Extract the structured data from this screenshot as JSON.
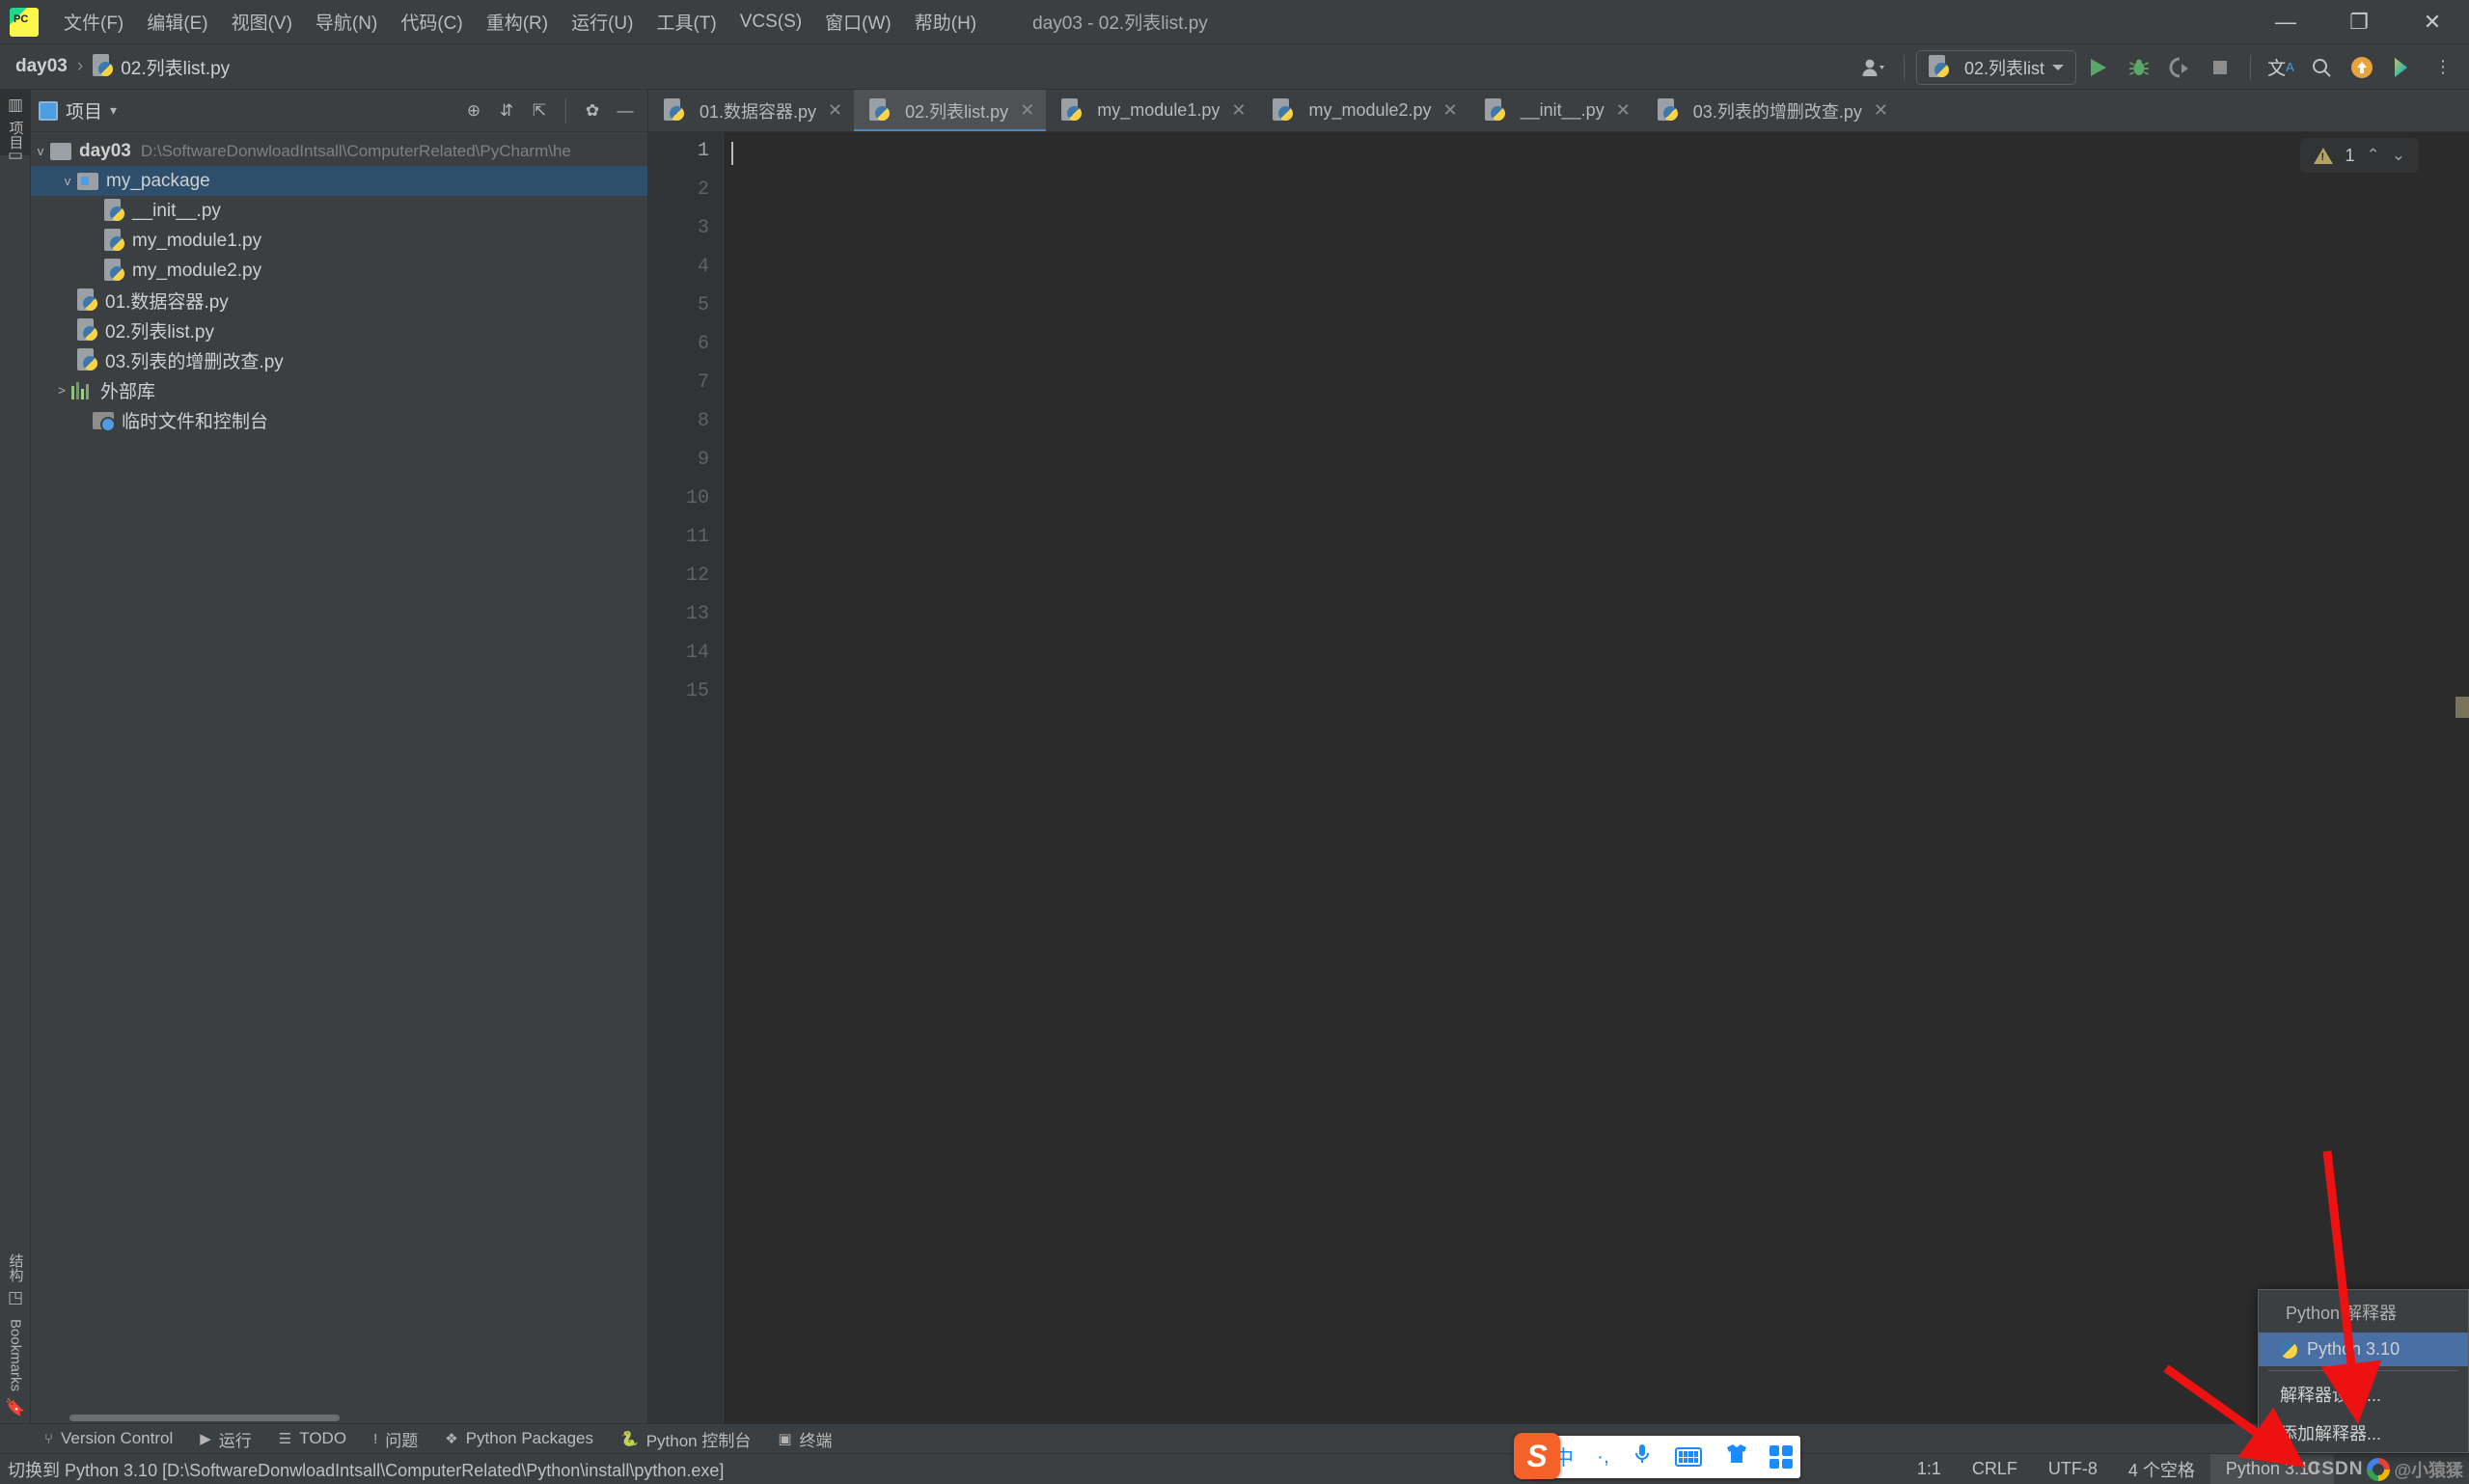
{
  "window": {
    "title": "day03 - 02.列表list.py",
    "minimize_label": "—",
    "maximize_label": "❐",
    "close_label": "✕"
  },
  "menu": {
    "items": [
      {
        "label": "文件(F)"
      },
      {
        "label": "编辑(E)"
      },
      {
        "label": "视图(V)"
      },
      {
        "label": "导航(N)"
      },
      {
        "label": "代码(C)"
      },
      {
        "label": "重构(R)"
      },
      {
        "label": "运行(U)"
      },
      {
        "label": "工具(T)"
      },
      {
        "label": "VCS(S)"
      },
      {
        "label": "窗口(W)"
      },
      {
        "label": "帮助(H)"
      }
    ]
  },
  "breadcrumb": {
    "project": "day03",
    "separator": "›",
    "file": "02.列表list.py"
  },
  "nav_right": {
    "account_icon": "user-icon",
    "run_config": "02.列表list",
    "run_tooltip": "运行",
    "debug_tooltip": "调试",
    "coverage_tooltip": "运行覆盖率",
    "stop_tooltip": "停止",
    "translate_icon": "文A",
    "search_icon": "⌕",
    "update_icon": "↑",
    "ai_icon": "▶",
    "more_icon": "⋮"
  },
  "toolstrip": {
    "top": [
      {
        "label": "项目",
        "icon": "project-icon",
        "active": true
      },
      {
        "label": "",
        "icon": "commit-icon",
        "active": false
      }
    ],
    "bottom": [
      {
        "label": "结构",
        "icon": "structure-icon"
      },
      {
        "label": "Bookmarks",
        "icon": "bookmark-icon"
      }
    ]
  },
  "project_panel": {
    "title": "项目",
    "dropdown_caret": "▾",
    "actions": [
      {
        "name": "locate-icon",
        "glyph": "⊕"
      },
      {
        "name": "expand-all-icon",
        "glyph": "⇵"
      },
      {
        "name": "collapse-all-icon",
        "glyph": "⇱"
      },
      {
        "name": "settings-gear-icon",
        "glyph": "✿"
      },
      {
        "name": "hide-panel-icon",
        "glyph": "—"
      }
    ],
    "tree": [
      {
        "label": "day03",
        "path": "D:\\SoftwareDonwloadIntsall\\ComputerRelated\\PyCharm\\he",
        "type": "folder",
        "indent": 0,
        "arrow": "v",
        "bold": true,
        "selected": false
      },
      {
        "label": "my_package",
        "path": "",
        "type": "package",
        "indent": 1,
        "arrow": "v",
        "bold": false,
        "selected": true
      },
      {
        "label": "__init__.py",
        "path": "",
        "type": "python",
        "indent": 2,
        "arrow": "",
        "bold": false,
        "selected": false
      },
      {
        "label": "my_module1.py",
        "path": "",
        "type": "python",
        "indent": 2,
        "arrow": "",
        "bold": false,
        "selected": false
      },
      {
        "label": "my_module2.py",
        "path": "",
        "type": "python",
        "indent": 2,
        "arrow": "",
        "bold": false,
        "selected": false
      },
      {
        "label": "01.数据容器.py",
        "path": "",
        "type": "python",
        "indent": 1,
        "arrow": "",
        "bold": false,
        "selected": false
      },
      {
        "label": "02.列表list.py",
        "path": "",
        "type": "python",
        "indent": 1,
        "arrow": "",
        "bold": false,
        "selected": false
      },
      {
        "label": "03.列表的增删改查.py",
        "path": "",
        "type": "python",
        "indent": 1,
        "arrow": "",
        "bold": false,
        "selected": false
      },
      {
        "label": "外部库",
        "path": "",
        "type": "library",
        "indent": 0,
        "arrow": ">",
        "bold": false,
        "selected": false
      },
      {
        "label": "临时文件和控制台",
        "path": "",
        "type": "console",
        "indent": 0,
        "arrow": "",
        "bold": false,
        "selected": false
      }
    ]
  },
  "editor": {
    "tabs": [
      {
        "label": "01.数据容器.py",
        "active": false
      },
      {
        "label": "02.列表list.py",
        "active": true
      },
      {
        "label": "my_module1.py",
        "active": false
      },
      {
        "label": "my_module2.py",
        "active": false
      },
      {
        "label": "__init__.py",
        "active": false
      },
      {
        "label": "03.列表的增删改查.py",
        "active": false
      }
    ],
    "tab_close_glyph": "✕",
    "line_numbers": [
      "1",
      "2",
      "3",
      "4",
      "5",
      "6",
      "7",
      "8",
      "9",
      "10",
      "11",
      "12",
      "13",
      "14",
      "15"
    ],
    "current_line": 1,
    "content": "",
    "inspection": {
      "warning_count": "1",
      "up_glyph": "⌃",
      "down_glyph": "⌄"
    }
  },
  "bottom_bar": {
    "items": [
      {
        "label": "Version Control",
        "glyph": "⑂"
      },
      {
        "label": "运行",
        "glyph": "▶"
      },
      {
        "label": "TODO",
        "glyph": "☰"
      },
      {
        "label": "问题",
        "glyph": "!"
      },
      {
        "label": "Python Packages",
        "glyph": "❖"
      },
      {
        "label": "Python 控制台",
        "glyph": "🐍"
      },
      {
        "label": "终端",
        "glyph": "▣"
      }
    ]
  },
  "status_bar": {
    "message": "切换到 Python 3.10 [D:\\SoftwareDonwloadIntsall\\ComputerRelated\\Python\\install\\python.exe]",
    "caret_position": "1:1",
    "line_separator": "CRLF",
    "encoding": "UTF-8",
    "indent": "4 个空格",
    "interpreter": "Python 3.10"
  },
  "ime": {
    "name": "sogou-input-bar",
    "logo": "S",
    "mode": "中",
    "punctuation": "·,",
    "mic_icon": "🎤",
    "keyboard_icon": "keyboard-icon",
    "skin_icon": "shirt-icon",
    "apps_icon": "apps-icon"
  },
  "popup": {
    "title": "Python 解释器",
    "items": [
      {
        "label": "Python 3.10",
        "selected": true,
        "icon": "python-icon"
      },
      {
        "label": "解释器设置...",
        "selected": false,
        "icon": ""
      },
      {
        "label": "添加解释器...",
        "selected": false,
        "icon": ""
      }
    ]
  },
  "watermark": {
    "csdn": "CSDN",
    "handle": "@小猿猱"
  },
  "colors": {
    "background": "#3c3f41",
    "editor_bg": "#2b2b2b",
    "selection": "#2d4f6b",
    "accent": "#4a88c7",
    "popup_selected": "#4a6fa5",
    "annotation_arrow": "#ee1111",
    "warning": "#b5a268",
    "run_green": "#59a869"
  }
}
